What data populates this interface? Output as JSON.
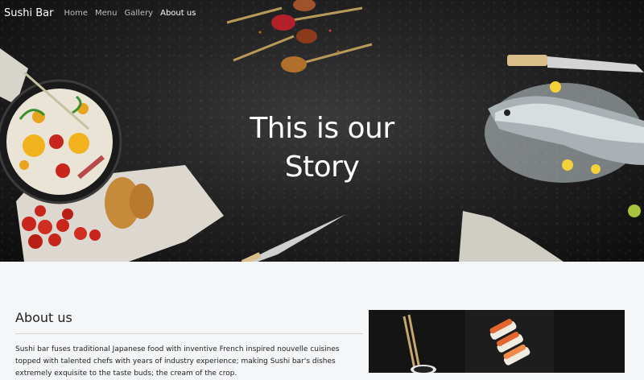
{
  "nav": {
    "brand": "Sushi Bar",
    "links": [
      {
        "label": "Home"
      },
      {
        "label": "Menu"
      },
      {
        "label": "Gallery"
      },
      {
        "label": "About us",
        "active": true
      }
    ]
  },
  "hero": {
    "title_line1": "This is our",
    "title_line2": "Story",
    "background": "dark slate with food props",
    "colors": {
      "text": "#ffffff",
      "nav_inactive": "#bdbdbd"
    }
  },
  "about": {
    "heading": "About us",
    "text": "Sushi bar fuses traditional Japanese food with inventive French inspired nouvelle cuisines topped with talented chefs with years of industry experience; making Sushi bar's dishes extremely exquisite to the taste buds; the cream of the crop.",
    "image_alt": "sushi rolls with chopsticks"
  },
  "colors": {
    "page_bg": "#f4f6f8",
    "hero_bg": "#1e1e1e"
  }
}
